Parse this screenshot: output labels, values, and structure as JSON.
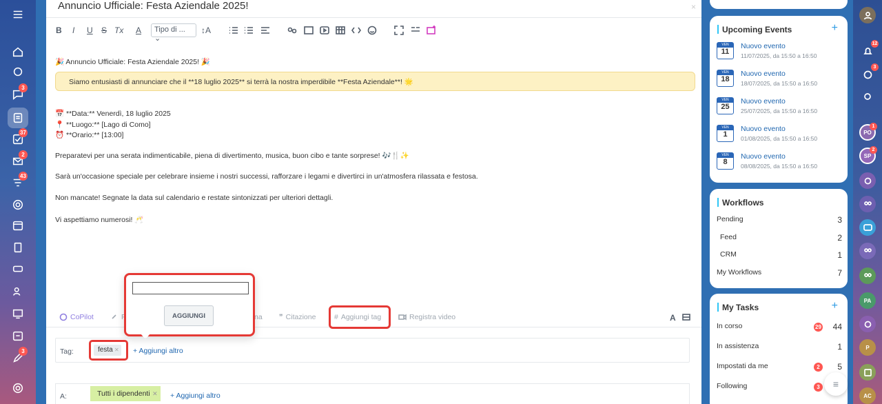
{
  "editor": {
    "title": "Annuncio Ufficiale: Festa Aziendale 2025!",
    "close": "×",
    "toolbar": {
      "bold": "B",
      "italic": "I",
      "underline": "U",
      "strike": "S",
      "clear_format": "Tx",
      "font_color": "A",
      "style_select": "Tipo di ...",
      "font_size": "↕A"
    },
    "content": {
      "line1": "🎉 Annuncio Ufficiale: Festa Aziendale 2025! 🎉",
      "highlight": "Siamo entusiasti di annunciare che il **18 luglio 2025** si terrà la nostra imperdibile **Festa Aziendale**! 🌟",
      "date": "📅 **Data:** Venerdì, 18 luglio 2025",
      "place": "📍 **Luogo:** [Lago di Como]",
      "time": "⏰ **Orario:** [13:00]",
      "p1": "Preparatevi per una serata indimenticabile, piena di divertimento, musica, buon cibo e tante sorprese! 🎶🍴✨",
      "p2": "Sarà un'occasione speciale per celebrare insieme i nostri successi, rafforzare i legami e divertirci in un'atmosfera rilassata e festosa.",
      "p3": "Non mancate! Segnate la data sul calendario e restate sintonizzati per ulteriori dettagli.",
      "p4": "Vi aspettiamo numerosi! 🥂"
    },
    "actions": {
      "copilot": "CoPilot",
      "file": "F",
      "citation_prefix": "na",
      "citation": "Citazione",
      "add_tag": "Aggiungi tag",
      "record_video": "Registra video",
      "font_a": "A"
    },
    "popup": {
      "input_value": "",
      "button": "AGGIUNGI"
    },
    "tags": {
      "label": "Tag:",
      "chip": "festa",
      "add_more": "+ Aggiungi altro"
    },
    "to": {
      "label": "A:",
      "chip": "Tutti i dipendenti",
      "add_more": "+ Aggiungi altro"
    }
  },
  "leftbar": {
    "badges": {
      "chat": "3",
      "tasks": "37",
      "mail": "2",
      "filters": "43",
      "edit": "3"
    }
  },
  "upcoming_events": {
    "title": "Upcoming Events",
    "plus": "+",
    "items": [
      {
        "dow": "VEN",
        "day": "11",
        "name": "Nuovo evento",
        "time": "11/07/2025, da 15:50 a 16:50"
      },
      {
        "dow": "VEN",
        "day": "18",
        "name": "Nuovo evento",
        "time": "18/07/2025, da 15:50 a 16:50"
      },
      {
        "dow": "VEN",
        "day": "25",
        "name": "Nuovo evento",
        "time": "25/07/2025, da 15:50 a 16:50"
      },
      {
        "dow": "VEN",
        "day": "1",
        "name": "Nuovo evento",
        "time": "01/08/2025, da 15:50 a 16:50"
      },
      {
        "dow": "VEN",
        "day": "8",
        "name": "Nuovo evento",
        "time": "08/08/2025, da 15:50 a 16:50"
      }
    ]
  },
  "workflows": {
    "title": "Workflows",
    "rows": [
      {
        "label": "Pending",
        "value": "3"
      },
      {
        "label": "Feed",
        "value": "2"
      },
      {
        "label": "CRM",
        "value": "1"
      },
      {
        "label": "My Workflows",
        "value": "7"
      }
    ]
  },
  "my_tasks": {
    "title": "My Tasks",
    "plus": "+",
    "rows": [
      {
        "label": "In corso",
        "badge": "29",
        "value": "44"
      },
      {
        "label": "In assistenza",
        "badge": "",
        "value": "1"
      },
      {
        "label": "Impostati da me",
        "badge": "2",
        "value": "5"
      },
      {
        "label": "Following",
        "badge": "3",
        "value": ""
      }
    ]
  },
  "rightbar": {
    "badges": {
      "notifications": "12",
      "copilot": "3",
      "po": "1",
      "sp": "2"
    },
    "avatars": {
      "po": "PO",
      "sp": "SP",
      "pa": "PA",
      "p": "P",
      "ac": "AC"
    }
  },
  "colors": {
    "accent_blue": "#2067b0",
    "badge_red": "#ff5752",
    "highlight_yellow": "#fdf1c4",
    "annotation_red": "#e53935",
    "chip_green": "#d7efa3"
  }
}
